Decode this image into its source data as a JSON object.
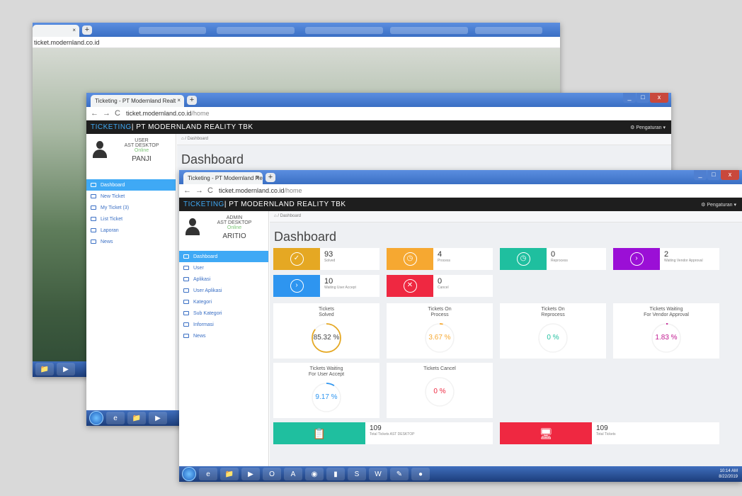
{
  "back_window": {
    "tab_close": "×",
    "new_tab": "+",
    "url": "ticket.modernland.co.id"
  },
  "mid_window": {
    "tab_title": "Ticketing - PT Modernland Realt",
    "tab_close": "×",
    "new_tab": "+",
    "url_host": "ticket.modernland.co.id",
    "url_path": "/home",
    "brand_accent": "TICKETING",
    "brand_rest": " | PT MODERNLAND REALITY TBK",
    "settings": "Pengaturan",
    "user_role": "USER",
    "user_dept": "AST DESKTOP",
    "user_status": "Online",
    "user_name": "PANJI",
    "breadcrumb": "Dashboard",
    "page_title": "Dashboard",
    "menu": [
      "Dashboard",
      "New Ticket",
      "My Ticket (3)",
      "List Ticket",
      "Laporan",
      "News"
    ]
  },
  "front_window": {
    "tab_title": "Ticketing - PT Modernland Realt",
    "tab_close": "×",
    "new_tab": "+",
    "url_host": "ticket.modernland.co.id",
    "url_path": "/home",
    "brand_accent": "TICKETING",
    "brand_rest": " | PT MODERNLAND REALITY TBK",
    "settings": "Pengaturan",
    "user_role": "ADMIN",
    "user_dept": "AST DESKTOP",
    "user_status": "Online",
    "user_name": "ARITIO",
    "breadcrumb": "Dashboard",
    "page_title": "Dashboard",
    "menu": [
      "Dashboard",
      "User",
      "Aplikasi",
      "User Aplikasi",
      "Kategori",
      "Sub Kategori",
      "Informasi",
      "News"
    ],
    "stats": [
      {
        "value": "93",
        "label": "Solved",
        "color": "#e5a823"
      },
      {
        "value": "4",
        "label": "Process",
        "color": "#f6a831"
      },
      {
        "value": "0",
        "label": "Reprocess",
        "color": "#1fbf9f"
      },
      {
        "value": "2",
        "label": "Waiting Vendor Approval",
        "color": "#9b0fd6"
      },
      {
        "value": "10",
        "label": "Waiting User Accept",
        "color": "#2e95f0"
      },
      {
        "value": "0",
        "label": "Cancel",
        "color": "#ef2841"
      }
    ],
    "gauges": [
      {
        "title1": "Tickets",
        "title2": "Solved",
        "pct": "85.32 %",
        "value": 85.32,
        "color": "#e5a823"
      },
      {
        "title1": "Tickets On",
        "title2": "Process",
        "pct": "3.67 %",
        "value": 3.67,
        "color": "#f6a831"
      },
      {
        "title1": "Tickets On",
        "title2": "Reprocess",
        "pct": "0 %",
        "value": 0,
        "color": "#1fbf9f"
      },
      {
        "title1": "Tickets Waiting",
        "title2": "For Vendor Approval",
        "pct": "1.83 %",
        "value": 1.83,
        "color": "#c0178f"
      },
      {
        "title1": "Tickets Waiting",
        "title2": "For User Accept",
        "pct": "9.17 %",
        "value": 9.17,
        "color": "#2e95f0"
      },
      {
        "title1": "Tickets Cancel",
        "title2": "",
        "pct": "0 %",
        "value": 0,
        "color": "#ef2841"
      }
    ],
    "totals": [
      {
        "value": "109",
        "label": "Total Tickets AST DESKTOP",
        "color": "#1fbf9f"
      },
      {
        "value": "109",
        "label": "Total Tickets",
        "color": "#ef2841"
      }
    ],
    "clock_time": "10:14 AM",
    "clock_date": "8/22/2019"
  }
}
